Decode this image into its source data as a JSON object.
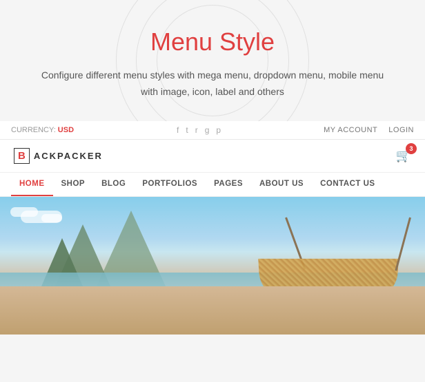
{
  "hero": {
    "title": "Menu Style",
    "description": "Configure different menu styles with mega menu, dropdown menu, mobile menu with image, icon, label and others"
  },
  "topbar": {
    "currency_label": "CURRENCY:",
    "currency_value": "USD",
    "social_icons": [
      {
        "name": "facebook-icon",
        "symbol": "f"
      },
      {
        "name": "twitter-icon",
        "symbol": "t"
      },
      {
        "name": "rss-icon",
        "symbol": "r"
      },
      {
        "name": "google-plus-icon",
        "symbol": "g"
      },
      {
        "name": "pinterest-icon",
        "symbol": "p"
      }
    ],
    "links": [
      {
        "label": "MY ACCOUNT",
        "name": "my-account-link"
      },
      {
        "label": "LOGIN",
        "name": "login-link"
      }
    ]
  },
  "navbar": {
    "logo_letter": "B",
    "logo_text": "ACKPACKER",
    "cart_count": "3"
  },
  "nav_menu": {
    "items": [
      {
        "label": "HOME",
        "active": true
      },
      {
        "label": "SHOP",
        "active": false
      },
      {
        "label": "BLOG",
        "active": false
      },
      {
        "label": "PORTFOLIOS",
        "active": false
      },
      {
        "label": "PAGES",
        "active": false
      },
      {
        "label": "ABOUT US",
        "active": false
      },
      {
        "label": "CONTACT US",
        "active": false
      }
    ]
  },
  "colors": {
    "accent": "#e04040",
    "text_dark": "#333",
    "text_medium": "#555",
    "text_light": "#999"
  }
}
